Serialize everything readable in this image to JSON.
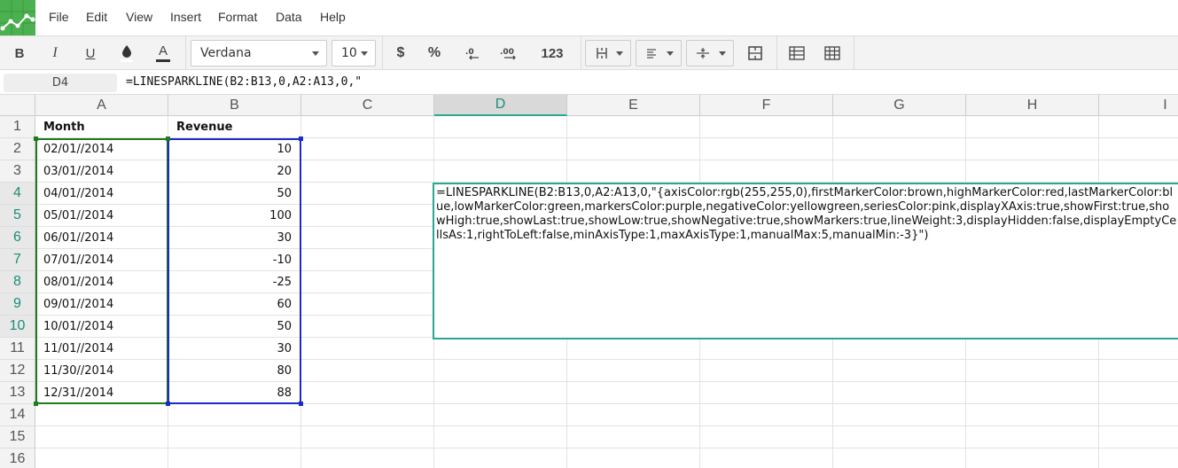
{
  "menubar": {
    "items": [
      "File",
      "Edit",
      "View",
      "Insert",
      "Format",
      "Data",
      "Help"
    ]
  },
  "toolbar": {
    "bold": "B",
    "italic": "I",
    "underline": "U",
    "font_color": "A",
    "font_family": "Verdana",
    "font_size": "10",
    "currency": "$",
    "percent": "%",
    "decrease_decimal": ".0",
    "increase_decimal": ".00",
    "number_format": "123"
  },
  "formula_bar": {
    "name_box": "D4",
    "formula": "=LINESPARKLINE(B2:B13,0,A2:A13,0,\""
  },
  "grid": {
    "columns": [
      "A",
      "B",
      "C",
      "D",
      "E",
      "F",
      "G",
      "H",
      "I"
    ],
    "selected_column": "D",
    "rows": [
      "1",
      "2",
      "3",
      "4",
      "5",
      "6",
      "7",
      "8",
      "9",
      "10",
      "11",
      "12",
      "13",
      "14",
      "15",
      "16"
    ],
    "headers": {
      "a": "Month",
      "b": "Revenue"
    },
    "data": [
      {
        "month": "02/01//2014",
        "revenue": "10"
      },
      {
        "month": "03/01//2014",
        "revenue": "20"
      },
      {
        "month": "04/01//2014",
        "revenue": "50"
      },
      {
        "month": "05/01//2014",
        "revenue": "100"
      },
      {
        "month": "06/01//2014",
        "revenue": "30"
      },
      {
        "month": "07/01//2014",
        "revenue": "-10"
      },
      {
        "month": "08/01//2014",
        "revenue": "-25"
      },
      {
        "month": "09/01//2014",
        "revenue": "60"
      },
      {
        "month": "10/01//2014",
        "revenue": "50"
      },
      {
        "month": "11/01//2014",
        "revenue": "30"
      },
      {
        "month": "11/30//2014",
        "revenue": "80"
      },
      {
        "month": "12/31//2014",
        "revenue": "88"
      }
    ]
  },
  "editor": {
    "text": "=LINESPARKLINE(B2:B13,0,A2:A13,0,\"{axisColor:rgb(255,255,0),firstMarkerColor:brown,highMarkerColor:red,lastMarkerColor:blue,lowMarkerColor:green,markersColor:purple,negativeColor:yellowgreen,seriesColor:pink,displayXAxis:true,showFirst:true,showHigh:true,showLast:true,showLow:true,showNegative:true,showMarkers:true,lineWeight:3,displayHidden:false,displayEmptyCellsAs:1,rightToLeft:false,minAxisType:1,maxAxisType:1,manualMax:5,manualMin:-3}\")"
  },
  "colors": {
    "accent": "#2aa693",
    "logo": "#4bb04f",
    "range_a": "#1e7b1e",
    "range_b": "#1c2dc4"
  }
}
